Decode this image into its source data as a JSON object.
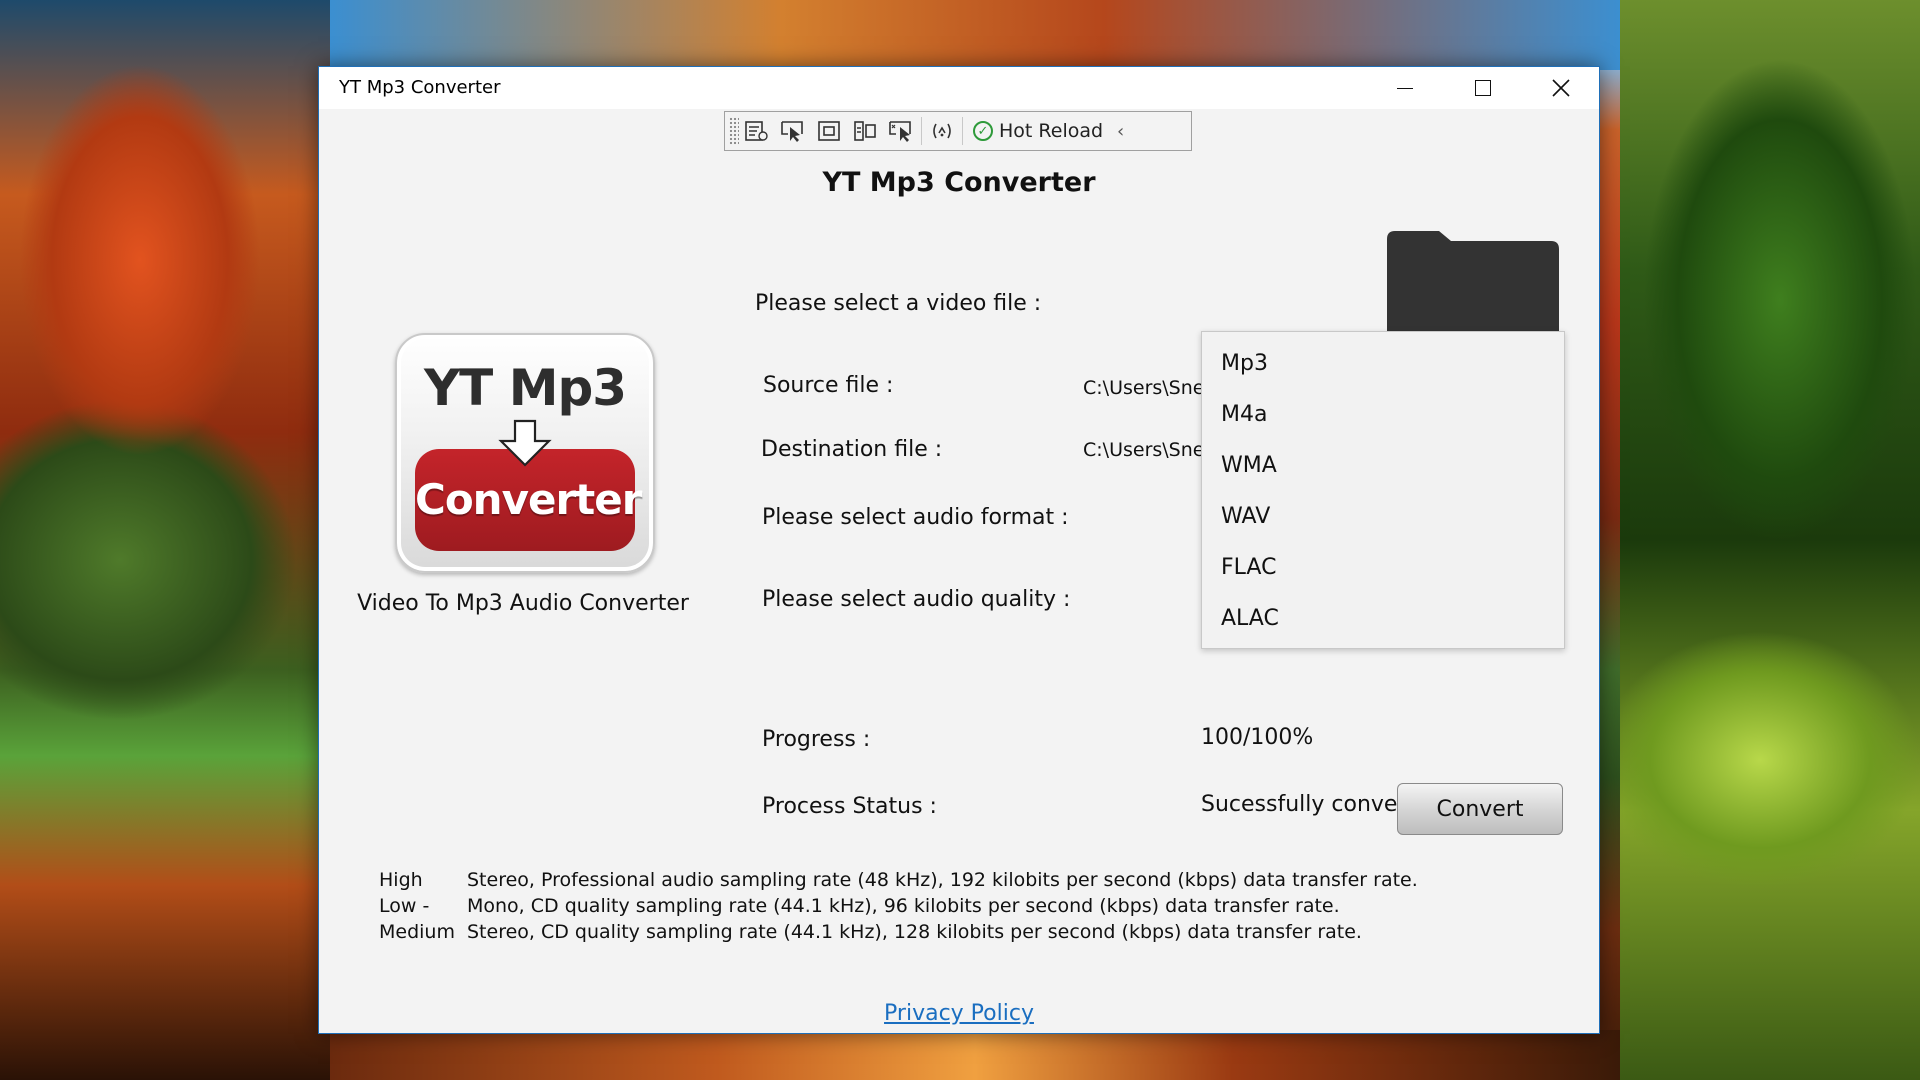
{
  "window": {
    "title": "YT Mp3 Converter",
    "controls": [
      "minimize",
      "maximize",
      "close"
    ]
  },
  "debug_toolbar": {
    "tools": [
      "live-visual-tree-icon",
      "select-element-icon",
      "display-layout-adorners-icon",
      "track-focused-element-icon",
      "preview-selection-icon",
      "binding-failures-icon"
    ],
    "hot_reload_label": "Hot Reload"
  },
  "header": {
    "heading": "YT Mp3 Converter"
  },
  "logo": {
    "top_text": "YT Mp3",
    "band_text": "Converter",
    "band_color": "#b01f25"
  },
  "subtitle": "Video To Mp3 Audio Converter",
  "form": {
    "select_video_label": "Please select a video file :",
    "source_label": "Source file :",
    "source_value": "C:\\Users\\Sne",
    "destination_label": "Destination file :",
    "destination_value": "C:\\Users\\Sne",
    "format_label": "Please select audio format :",
    "quality_label": "Please select audio quality :",
    "progress_label": "Progress :",
    "progress_value": "100/100%",
    "status_label": "Process Status :",
    "status_value": "Sucessfully converted to audio."
  },
  "format_dropdown": {
    "options": [
      "Mp3",
      "M4a",
      "WMA",
      "WAV",
      "FLAC",
      "ALAC"
    ]
  },
  "convert_button": "Convert",
  "quality_notes": [
    {
      "name": "High",
      "desc": "Stereo, Professional audio sampling rate (48 kHz), 192 kilobits per second (kbps) data transfer rate."
    },
    {
      "name": "Low -",
      "desc": "Mono, CD quality sampling rate (44.1 kHz), 96 kilobits per second (kbps) data transfer rate."
    },
    {
      "name": "Medium",
      "desc": "Stereo, CD quality sampling rate (44.1 kHz), 128 kilobits per second (kbps) data transfer rate."
    }
  ],
  "privacy_link": "Privacy Policy",
  "colors": {
    "link": "#1a6ec0",
    "window_border": "#1f6fb8",
    "hot_reload_check": "#2e9a3a"
  }
}
